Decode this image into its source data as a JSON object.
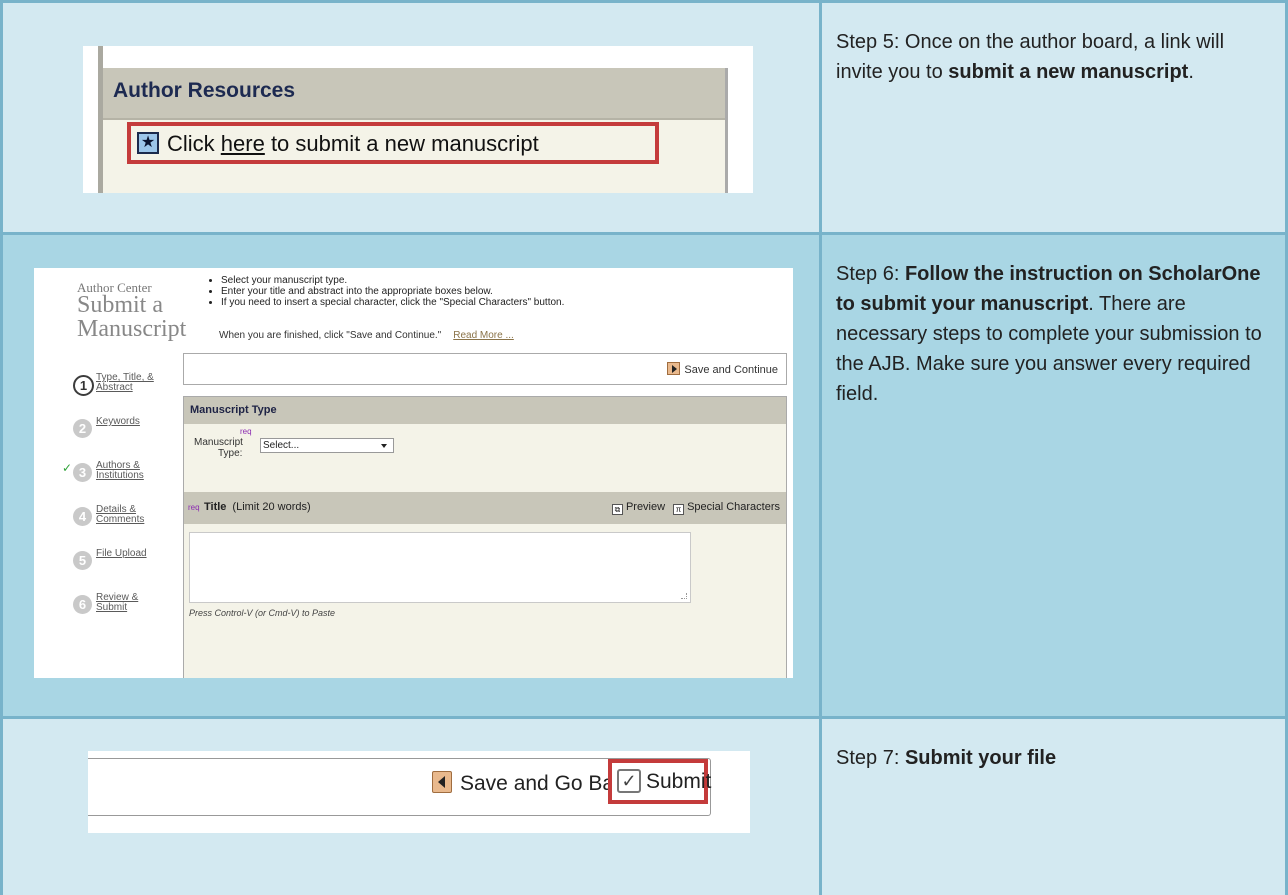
{
  "steps": [
    {
      "text_prefix": "Step 5: Once on the author board, a link will invite you to ",
      "text_bold": "submit a new manuscript",
      "text_suffix": "."
    },
    {
      "text_prefix": "Step 6: ",
      "text_bold": "Follow the instruction on ScholarOne to submit your manuscript",
      "text_suffix": ". There are necessary steps to complete your submission to the AJB. Make sure you answer every required field."
    },
    {
      "text_prefix": "Step 7: ",
      "text_bold": "Submit your file",
      "text_suffix": ""
    }
  ],
  "shot1": {
    "heading": "Author Resources",
    "link_prefix": "Click ",
    "link_word": "here",
    "link_suffix": " to submit a new manuscript",
    "star_icon": "star-icon"
  },
  "shot2": {
    "center_title": "Author Center",
    "title_line1": "Submit a",
    "title_line2": "Manuscript",
    "instructions": [
      "Select your manuscript type.",
      "Enter your title and abstract into the appropriate boxes below.",
      "If you need to insert a special character, click the \"Special Characters\" button."
    ],
    "finish_text": "When you are finished, click \"Save and Continue.\"",
    "read_more": "Read More ...",
    "nav": [
      {
        "num": "1",
        "label": "Type, Title, & Abstract",
        "state": "active"
      },
      {
        "num": "2",
        "label": "Keywords",
        "state": "todo"
      },
      {
        "num": "3",
        "label": "Authors & Institutions",
        "state": "done"
      },
      {
        "num": "4",
        "label": "Details & Comments",
        "state": "todo"
      },
      {
        "num": "5",
        "label": "File Upload",
        "state": "todo"
      },
      {
        "num": "6",
        "label": "Review & Submit",
        "state": "todo"
      }
    ],
    "save_continue": "Save and Continue",
    "manuscript_type_heading": "Manuscript Type",
    "req": "req",
    "manuscript_type_label_1": "Manuscript",
    "manuscript_type_label_2": "Type:",
    "select_value": "Select...",
    "title_label": "Title",
    "title_limit": "(Limit 20 words)",
    "preview": "Preview",
    "special_characters": "Special Characters",
    "paste_hint": "Press Control-V (or Cmd-V) to Paste",
    "title_value": ""
  },
  "shot3": {
    "back_label": "Save and Go Back",
    "submit_label": "Submit"
  },
  "colors": {
    "row_light": "#d3e9f1",
    "row_dark": "#a9d6e4",
    "border": "#78b3ca",
    "highlight": "#c43b3b"
  }
}
